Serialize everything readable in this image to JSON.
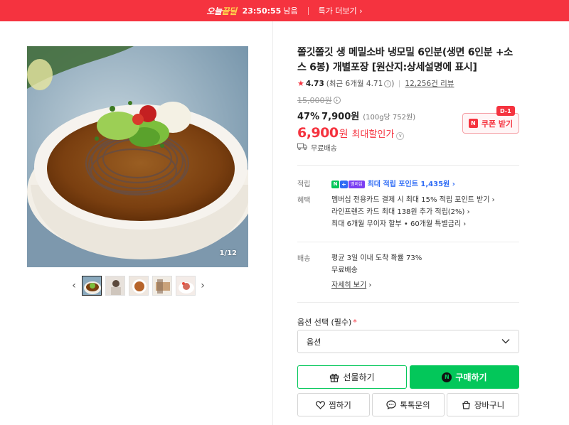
{
  "topbar": {
    "logo_pre": "오늘",
    "logo_post": "끝딜",
    "timer": "23:50:55",
    "timer_suffix": "남음",
    "more_label": "특가 더보기",
    "bg_color": "#f5333f"
  },
  "gallery": {
    "counter": "1/12",
    "prev_icon": "chevron-left-icon",
    "next_icon": "chevron-right-icon",
    "thumb_count": 5
  },
  "product": {
    "title": "쫄깃쫄깃 생 메밀소바 냉모밀 6인분(생면 6인분 +소스 6봉) 개별포장 [원산지:상세설명에 표시]",
    "rating": "4.73",
    "recent_rating": "(최근 6개월 4.71",
    "review_count": "12,256건 리뷰",
    "original_price": "15,000원",
    "discount_pct": "47%",
    "sale_price": "7,900원",
    "unit_price": "(100g당 752원)",
    "max_price_num": "6,900",
    "max_price_won": "원",
    "max_price_label": "최대할인가",
    "shipping_label": "무료배송"
  },
  "coupon": {
    "n_mark": "N",
    "label": "쿠폰 받기",
    "dday": "D-1"
  },
  "points": {
    "key": "적립",
    "badge_n": "N",
    "badge_plus": "+",
    "badge_tag": "멤버십",
    "text": "최대 적립 포인트 1,435원 "
  },
  "benefits": {
    "key": "혜택",
    "lines": [
      "멤버십 전용카드 결제 시 최대 15% 적립 포인트 받기 ",
      "라인프렌즈 카드 최대 138원 추가 적립(2%) ",
      "최대 6개월 무이자 할부 • 60개월 특별금리 "
    ]
  },
  "delivery": {
    "key": "배송",
    "line1": "평균 3일 이내 도착 확률 73%",
    "line2": "무료배송",
    "detail_link": "자세히 보기"
  },
  "option": {
    "label": "옵션 선택 (필수)",
    "required_mark": "*",
    "select_value": "옵션"
  },
  "actions": {
    "gift": "선물하기",
    "buy": "구매하기",
    "buy_n": "N",
    "wish": "찜하기",
    "talk": "톡톡문의",
    "cart": "장바구니"
  },
  "colors": {
    "accent_red": "#f5333f",
    "naver_green": "#03c75a",
    "point_blue": "#2f6cf5"
  }
}
